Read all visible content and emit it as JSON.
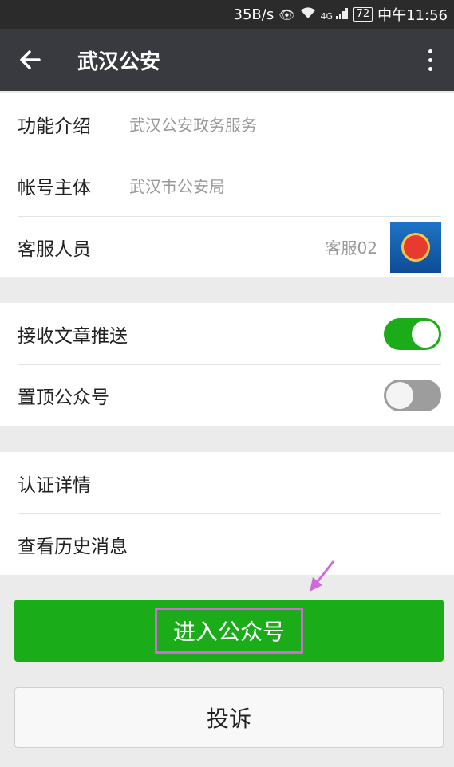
{
  "status_bar": {
    "net_speed": "35B/s",
    "eye_icon": "eye-icon",
    "wifi_icon": "wifi-icon",
    "signal": "4G",
    "battery": "72",
    "time": "中午11:56"
  },
  "header": {
    "title": "武汉公安"
  },
  "info": {
    "intro_label": "功能介绍",
    "intro_value": "武汉公安政务服务",
    "owner_label": "帐号主体",
    "owner_value": "武汉市公安局",
    "cs_label": "客服人员",
    "cs_value": "客服02"
  },
  "settings": {
    "push_label": "接收文章推送",
    "push_on": true,
    "pin_label": "置顶公众号",
    "pin_on": false
  },
  "more": {
    "cert_label": "认证详情",
    "history_label": "查看历史消息"
  },
  "actions": {
    "enter_label": "进入公众号",
    "complain_label": "投诉"
  },
  "colors": {
    "accent_green": "#1aad19",
    "appbar": "#393a3f",
    "annotation": "#d06ad8"
  }
}
